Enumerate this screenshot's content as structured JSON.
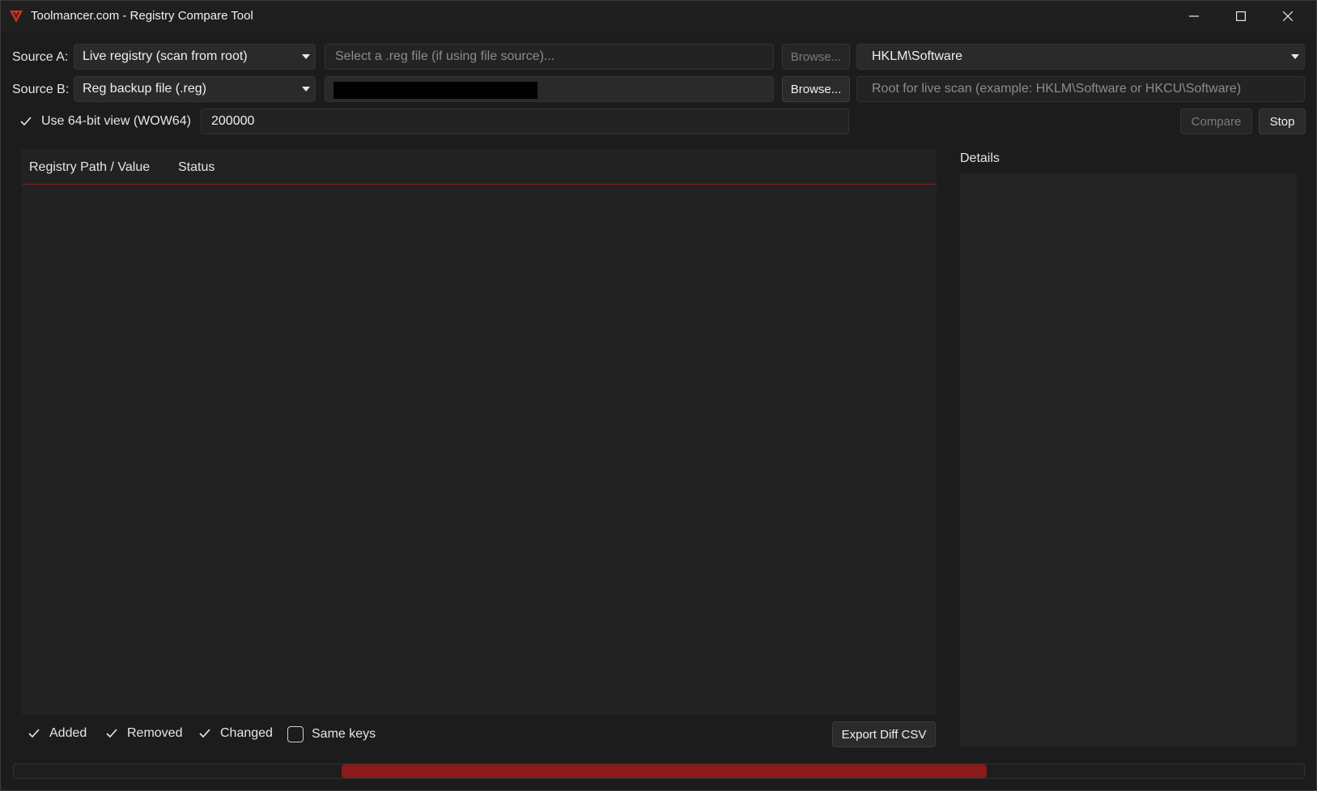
{
  "window": {
    "title": "Toolmancer.com - Registry Compare Tool",
    "app_icon": "toolmancer-logo-icon",
    "controls": [
      "minimize-icon",
      "maximize-icon",
      "close-icon"
    ]
  },
  "source_a": {
    "label": "Source A:",
    "type_selected": "Live registry (scan from root)",
    "file_placeholder": "Select a .reg file (if using file source)...",
    "browse_label": "Browse...",
    "root_selected": "HKLM\\Software"
  },
  "source_b": {
    "label": "Source B:",
    "type_selected": "Reg backup file (.reg)",
    "file_value": "",
    "browse_label": "Browse...",
    "root_placeholder": "Root for live scan (example: HKLM\\Software or HKCU\\Software)"
  },
  "options": {
    "wow64_label": "Use 64-bit view (WOW64)",
    "wow64_checked": true,
    "max_entries_value": "200000",
    "compare_label": "Compare",
    "stop_label": "Stop"
  },
  "results": {
    "columns": [
      "Registry Path / Value",
      "Status"
    ],
    "rows": []
  },
  "details": {
    "label": "Details",
    "text": ""
  },
  "filters": {
    "added_label": "Added",
    "added_checked": true,
    "removed_label": "Removed",
    "removed_checked": true,
    "changed_label": "Changed",
    "changed_checked": true,
    "same_label": "Same keys",
    "same_checked": false,
    "export_label": "Export Diff CSV"
  },
  "progress": {
    "indeterminate": true,
    "accent_color": "#8b1a1a"
  }
}
